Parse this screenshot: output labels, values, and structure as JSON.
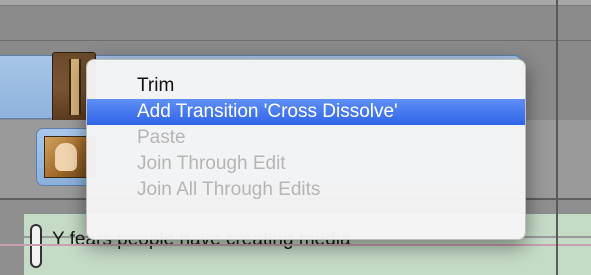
{
  "timeline": {
    "clip2_caption": "people have creating media",
    "title_clip_text": "Y fears people have creating media",
    "accent_clip_blue": "#9dbde5",
    "accent_title_green": "#c5dbc6"
  },
  "context_menu": {
    "items": [
      {
        "label": "Trim",
        "state": "enabled"
      },
      {
        "label": "Add Transition 'Cross Dissolve'",
        "state": "selected"
      },
      {
        "label": "Paste",
        "state": "disabled"
      },
      {
        "label": "Join Through Edit",
        "state": "disabled"
      },
      {
        "label": "Join All Through Edits",
        "state": "disabled"
      }
    ],
    "selection_color": "#3e74ef"
  }
}
